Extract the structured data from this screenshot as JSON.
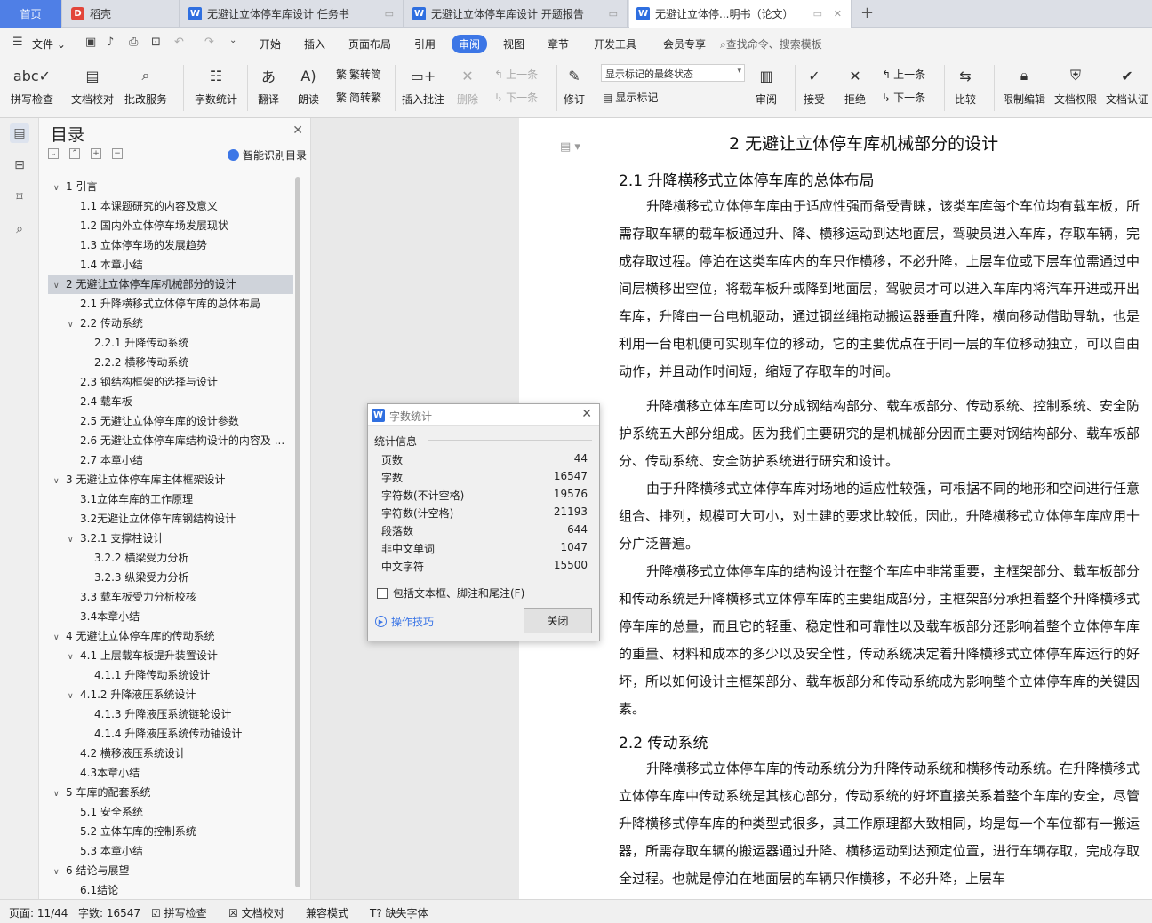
{
  "tabs": [
    {
      "label": "首页",
      "kind": "home"
    },
    {
      "label": "稻壳",
      "kind": "docer"
    },
    {
      "label": "无避让立体停车库设计 任务书",
      "kind": "doc"
    },
    {
      "label": "无避让立体停车库设计 开题报告",
      "kind": "doc"
    },
    {
      "label": "无避让立体停...明书（论文）",
      "kind": "doc",
      "active": true
    }
  ],
  "menu": {
    "items": [
      "文件",
      "开始",
      "插入",
      "页面布局",
      "引用",
      "审阅",
      "视图",
      "章节",
      "开发工具",
      "会员专享"
    ],
    "active": "审阅",
    "search": "查找命令、搜索模板"
  },
  "ribbon": {
    "spell": "拼写检查",
    "proof": "文档校对",
    "batch": "批改服务",
    "wordcount": "字数统计",
    "translate": "翻译",
    "read": "朗读",
    "t2s": "繁转简",
    "s2t": "简转繁",
    "insert_comment": "插入批注",
    "delete": "删除",
    "prev_comment": "上一条",
    "next_comment": "下一条",
    "revise": "修订",
    "markup_select": "显示标记的最终状态",
    "show_markup": "显示标记",
    "review": "审阅",
    "accept": "接受",
    "reject": "拒绝",
    "prev": "上一条",
    "next": "下一条",
    "compare": "比较",
    "restrict": "限制编辑",
    "permission": "文档权限",
    "certify": "文档认证"
  },
  "toc": {
    "title": "目录",
    "smart": "智能识别目录",
    "items": [
      {
        "text": "1  引言",
        "level": 0,
        "caret": "v"
      },
      {
        "text": "1.1  本课题研究的内容及意义",
        "level": 1
      },
      {
        "text": "1.2  国内外立体停车场发展现状",
        "level": 1
      },
      {
        "text": "1.3  立体停车场的发展趋势",
        "level": 1
      },
      {
        "text": "1.4  本章小结",
        "level": 1
      },
      {
        "text": "2  无避让立体停车库机械部分的设计",
        "level": 0,
        "caret": "v",
        "hl": true
      },
      {
        "text": "2.1  升降横移式立体停车库的总体布局",
        "level": 1
      },
      {
        "text": "2.2  传动系统",
        "level": 1,
        "caret": "v"
      },
      {
        "text": "2.2.1 升降传动系统",
        "level": 2
      },
      {
        "text": "2.2.2 横移传动系统",
        "level": 2
      },
      {
        "text": "2.3  钢结构框架的选择与设计",
        "level": 1
      },
      {
        "text": "2.4  载车板",
        "level": 1
      },
      {
        "text": "2.5  无避让立体停车库的设计参数",
        "level": 1
      },
      {
        "text": "2.6  无避让立体停车库结构设计的内容及 ...",
        "level": 1
      },
      {
        "text": "2.7  本章小结",
        "level": 1
      },
      {
        "text": "3  无避让立体停车库主体框架设计",
        "level": 0,
        "caret": "v"
      },
      {
        "text": "3.1立体车库的工作原理",
        "level": 1
      },
      {
        "text": "3.2无避让立体停车库钢结构设计",
        "level": 1
      },
      {
        "text": "3.2.1  支撑柱设计",
        "level": 1,
        "caret": "v"
      },
      {
        "text": "3.2.2  横梁受力分析",
        "level": 2
      },
      {
        "text": "3.2.3  纵梁受力分析",
        "level": 2
      },
      {
        "text": "3.3  载车板受力分析校核",
        "level": 1
      },
      {
        "text": "3.4本章小结",
        "level": 1
      },
      {
        "text": "4  无避让立体停车库的传动系统",
        "level": 0,
        "caret": "v"
      },
      {
        "text": "4.1  上层载车板提升装置设计",
        "level": 1,
        "caret": "v"
      },
      {
        "text": "4.1.1  升降传动系统设计",
        "level": 2
      },
      {
        "text": "4.1.2  升降液压系统设计",
        "level": 1,
        "caret": "v"
      },
      {
        "text": "4.1.3  升降液压系统链轮设计",
        "level": 2
      },
      {
        "text": "4.1.4  升降液压系统传动轴设计",
        "level": 2
      },
      {
        "text": "4.2  横移液压系统设计",
        "level": 1
      },
      {
        "text": "4.3本章小结",
        "level": 1
      },
      {
        "text": "5  车库的配套系统",
        "level": 0,
        "caret": "v"
      },
      {
        "text": "5.1  安全系统",
        "level": 1
      },
      {
        "text": "5.2  立体车库的控制系统",
        "level": 1
      },
      {
        "text": "5.3  本章小结",
        "level": 1
      },
      {
        "text": "6  结论与展望",
        "level": 0,
        "caret": "v"
      },
      {
        "text": "6.1结论",
        "level": 1
      }
    ]
  },
  "doc": {
    "h1": "2  无避让立体停车库机械部分的设计",
    "h2a": "2.1  升降横移式立体停车库的总体布局",
    "p1": "升降横移式立体停车库由于适应性强而备受青睐，该类车库每个车位均有载车板，所需存取车辆的载车板通过升、降、横移运动到达地面层，驾驶员进入车库，存取车辆，完成存取过程。停泊在这类车库内的车只作横移，不必升降，上层车位或下层车位需通过中间层横移出空位，将载车板升或降到地面层，驾驶员才可以进入车库内将汽车开进或开出车库，升降由一台电机驱动，通过钢丝绳拖动搬运器垂直升降，横向移动借助导轨，也是利用一台电机便可实现车位的移动，它的主要优点在于同一层的车位移动独立，可以自由动作，并且动作时间短，缩短了存取车的时间。",
    "p2": "升降横移立体车库可以分成钢结构部分、载车板部分、传动系统、控制系统、安全防护系统五大部分组成。因为我们主要研究的是机械部分因而主要对钢结构部分、载车板部分、传动系统、安全防护系统进行研究和设计。",
    "p3": "由于升降横移式立体停车库对场地的适应性较强，可根据不同的地形和空间进行任意组合、排列，规模可大可小，对土建的要求比较低，因此，升降横移式立体停车库应用十分广泛普遍。",
    "p4": "升降横移式立体停车库的结构设计在整个车库中非常重要，主框架部分、载车板部分和传动系统是升降横移式立体停车库的主要组成部分，主框架部分承担着整个升降横移式停车库的总量，而且它的轻重、稳定性和可靠性以及载车板部分还影响着整个立体停车库的重量、材料和成本的多少以及安全性，传动系统决定着升降横移式立体停车库运行的好坏，所以如何设计主框架部分、载车板部分和传动系统成为影响整个立体停车库的关键因素。",
    "h2b": "2.2  传动系统",
    "p5": "升降横移式立体停车库的传动系统分为升降传动系统和横移传动系统。在升降横移式立体停车库中传动系统是其核心部分，传动系统的好坏直接关系着整个车库的安全，尽管升降横移式停车库的种类型式很多，其工作原理都大致相同，均是每一个车位都有一搬运器，所需存取车辆的搬运器通过升降、横移运动到达预定位置，进行车辆存取，完成存取全过程。也就是停泊在地面层的车辆只作横移，不必升降，上层车"
  },
  "dialog": {
    "title": "字数统计",
    "group": "统计信息",
    "rows": [
      {
        "label": "页数",
        "value": "44"
      },
      {
        "label": "字数",
        "value": "16547"
      },
      {
        "label": "字符数(不计空格)",
        "value": "19576"
      },
      {
        "label": "字符数(计空格)",
        "value": "21193"
      },
      {
        "label": "段落数",
        "value": "644"
      },
      {
        "label": "非中文单词",
        "value": "1047"
      },
      {
        "label": "中文字符",
        "value": "15500"
      }
    ],
    "checkbox": "包括文本框、脚注和尾注(F)",
    "tips": "操作技巧",
    "close": "关闭"
  },
  "status": {
    "page": "页面: 11/44",
    "words": "字数: 16547",
    "spell": "拼写检查",
    "proof": "文档校对",
    "compat": "兼容模式",
    "font": "缺失字体"
  }
}
